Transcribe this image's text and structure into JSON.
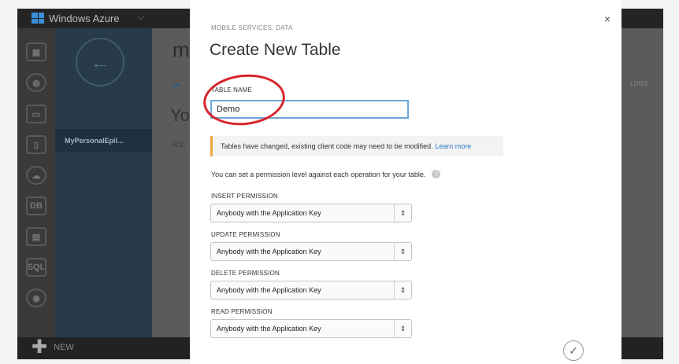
{
  "portal": {
    "brand": "Windows Azure",
    "brand_caret": "⌵",
    "back_icon": "←",
    "subnav_item": "MyPersonalEpil...",
    "bg_heading": "m",
    "bg_cloud": "☁",
    "bg_subheading": "Yo",
    "bg_add": "ADD",
    "bg_logs": "LOGS",
    "new_label": "NEW",
    "new_icon": "✚",
    "nav_icons": [
      "grid-icon",
      "globe-icon",
      "monitor-icon",
      "phone-icon",
      "cloud-icon",
      "db-icon",
      "table-icon",
      "sql-icon",
      "storage-icon"
    ],
    "nav_glyphs": [
      "▦",
      "◍",
      "▭",
      "▯",
      "☁",
      "DB",
      "▤",
      "SQL",
      "◉"
    ]
  },
  "modal": {
    "close": "×",
    "eyebrow": "MOBILE SERVICES: DATA",
    "title": "Create New Table",
    "table_name_label": "TABLE NAME",
    "table_name_value": "Demo",
    "warning_text": "Tables have changed, existing client code may need to be modified.",
    "warning_link": "Learn more",
    "permission_note": "You can set a permission level against each operation for your table.",
    "help_icon": "?",
    "permissions": [
      {
        "label": "INSERT PERMISSION",
        "value": "Anybody with the Application Key"
      },
      {
        "label": "UPDATE PERMISSION",
        "value": "Anybody with the Application Key"
      },
      {
        "label": "DELETE PERMISSION",
        "value": "Anybody with the Application Key"
      },
      {
        "label": "READ PERMISSION",
        "value": "Anybody with the Application Key"
      }
    ],
    "select_arrows": "⇕",
    "confirm_icon": "✓"
  },
  "colors": {
    "accent": "#6ea6d8",
    "highlight_circle": "#d7262d",
    "warning_bar": "#f0a53a",
    "link": "#2b78c5"
  }
}
